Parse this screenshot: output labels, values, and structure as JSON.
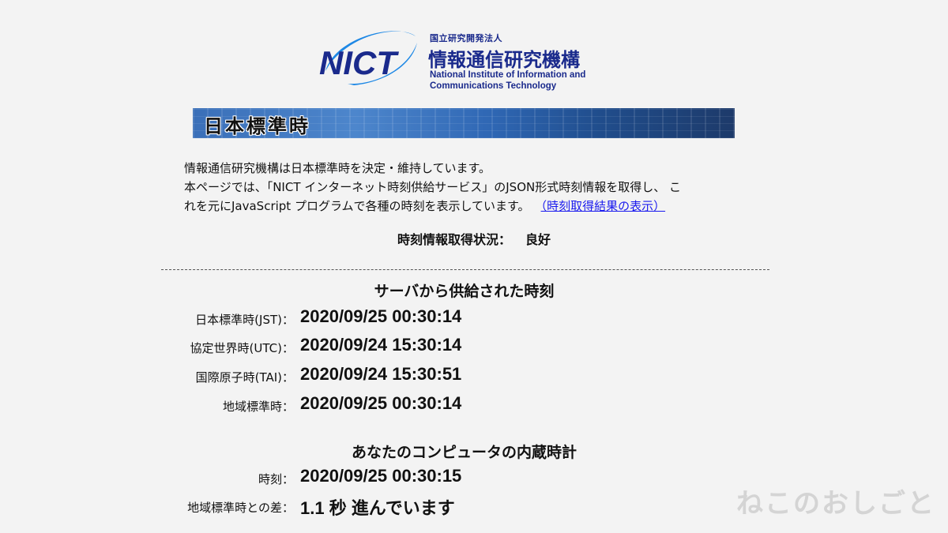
{
  "logo": {
    "mark_text": "NICT",
    "sub": "国立研究開発法人",
    "main": "情報通信研究機構",
    "en_line1": "National Institute of Information and",
    "en_line2": "Communications Technology",
    "brand_color": "#1a2a8c",
    "swoosh_color": "#1e88e5"
  },
  "banner": {
    "title": "日本標準時"
  },
  "intro": {
    "line1": "情報通信研究機構は日本標準時を決定・維持しています。",
    "line2": "本ページでは、「NICT インターネット時刻供給サービス」のJSON形式時刻情報を取得し、 こ",
    "line3": "れを元にJavaScript プログラムで各種の時刻を表示しています。",
    "link": "（時刻取得結果の表示）"
  },
  "status": {
    "label": "時刻情報取得状況：",
    "value": "良好"
  },
  "server": {
    "title": "サーバから供給された時刻",
    "rows": [
      {
        "label": "日本標準時(JST)：",
        "value": "2020/09/25 00:30:14"
      },
      {
        "label": "協定世界時(UTC)：",
        "value": "2020/09/24 15:30:14"
      },
      {
        "label": "国際原子時(TAI)：",
        "value": "2020/09/24 15:30:51"
      },
      {
        "label": "地域標準時：",
        "value": "2020/09/25 00:30:14"
      }
    ]
  },
  "local": {
    "title": "あなたのコンピュータの内蔵時計",
    "rows": [
      {
        "label": "時刻：",
        "value": "2020/09/25 00:30:15"
      },
      {
        "label": "地域標準時との差：",
        "value": "1.1 秒 進んでいます"
      }
    ]
  },
  "watermark": "ねこのおしごと"
}
